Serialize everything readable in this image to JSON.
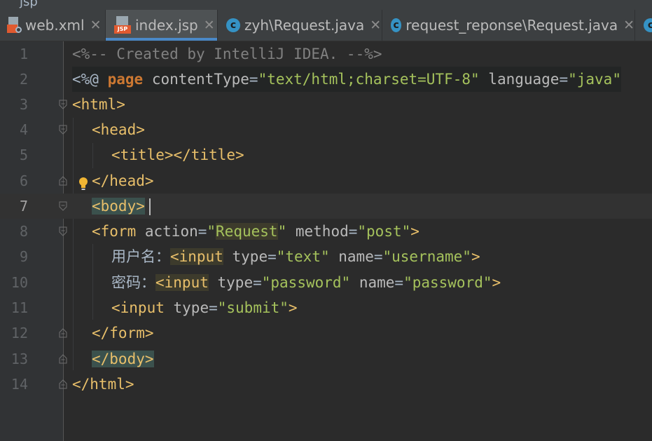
{
  "tabs": [
    {
      "label": "web.xml",
      "icon": "xml-file-icon",
      "active": false
    },
    {
      "label": "index.jsp",
      "icon": "jsp-file-icon",
      "icon_badge": "JSP",
      "active": true
    },
    {
      "label": "zyh\\Request.java",
      "icon": "class-icon",
      "icon_letter": "c",
      "active": false
    },
    {
      "label": "request_reponse\\Request.java",
      "icon": "class-icon",
      "icon_letter": "c",
      "active": false
    }
  ],
  "top_strip_text": "jsp",
  "editor": {
    "current_line": 7,
    "line_numbers": [
      "1",
      "2",
      "3",
      "4",
      "5",
      "6",
      "7",
      "8",
      "9",
      "10",
      "11",
      "12",
      "13",
      "14"
    ],
    "lines": {
      "l1": {
        "comment": "<%-- Created by IntelliJ IDEA. --%>"
      },
      "l2": {
        "open": "<%@",
        "directive": "page",
        "attr1": "contentType",
        "eq1": "=",
        "val1": "\"text/html;charset=UTF-8\"",
        "attr2": "language",
        "eq2": "=",
        "val2": "\"java\""
      },
      "l3": {
        "tag": "<html>"
      },
      "l4": {
        "tag": "<head>"
      },
      "l5": {
        "tag1": "<title>",
        "tag2": "</title>"
      },
      "l6": {
        "tag": "</head>"
      },
      "l7": {
        "tag": "<body>"
      },
      "l8": {
        "tag": "<form",
        "attr1": "action",
        "eq1": "=",
        "q1a": "\"",
        "val1": "Request",
        "q1b": "\"",
        "attr2": "method",
        "eq2": "=",
        "val2": "\"post\"",
        "end": ">"
      },
      "l9": {
        "text": "用户名：",
        "tag": "<input",
        "attr1": "type",
        "eq1": "=",
        "val1": "\"text\"",
        "attr2": "name",
        "eq2": "=",
        "val2": "\"username\"",
        "end": ">"
      },
      "l10": {
        "text": "密码：",
        "tag": "<input",
        "attr1": "type",
        "eq1": "=",
        "val1": "\"password\"",
        "attr2": "name",
        "eq2": "=",
        "val2": "\"password\"",
        "end": ">"
      },
      "l11": {
        "tag": "<input",
        "attr1": "type",
        "eq1": "=",
        "val1": "\"submit\"",
        "end": ">"
      },
      "l12": {
        "tag": "</form>"
      },
      "l13": {
        "tag": "</body>"
      },
      "l14": {
        "tag": "</html>"
      }
    }
  },
  "icons": {
    "fold": "fold-marker-icon",
    "intention": "lightbulb-icon"
  },
  "colors": {
    "background": "#2b2b2b",
    "tag": "#e8bf6a",
    "string": "#a5c25c",
    "comment": "#808080",
    "keyword": "#cc7832",
    "active_tab_underline": "#4a88c7"
  }
}
